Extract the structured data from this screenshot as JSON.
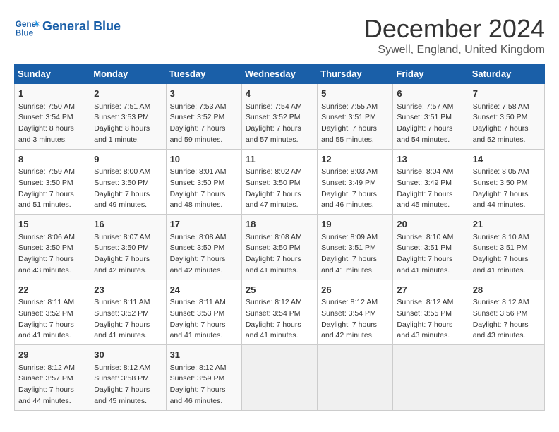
{
  "header": {
    "logo_text_general": "General",
    "logo_text_blue": "Blue",
    "month_year": "December 2024",
    "location": "Sywell, England, United Kingdom"
  },
  "days_of_week": [
    "Sunday",
    "Monday",
    "Tuesday",
    "Wednesday",
    "Thursday",
    "Friday",
    "Saturday"
  ],
  "weeks": [
    [
      {
        "day": "1",
        "sunrise": "Sunrise: 7:50 AM",
        "sunset": "Sunset: 3:54 PM",
        "daylight": "Daylight: 8 hours and 3 minutes."
      },
      {
        "day": "2",
        "sunrise": "Sunrise: 7:51 AM",
        "sunset": "Sunset: 3:53 PM",
        "daylight": "Daylight: 8 hours and 1 minute."
      },
      {
        "day": "3",
        "sunrise": "Sunrise: 7:53 AM",
        "sunset": "Sunset: 3:52 PM",
        "daylight": "Daylight: 7 hours and 59 minutes."
      },
      {
        "day": "4",
        "sunrise": "Sunrise: 7:54 AM",
        "sunset": "Sunset: 3:52 PM",
        "daylight": "Daylight: 7 hours and 57 minutes."
      },
      {
        "day": "5",
        "sunrise": "Sunrise: 7:55 AM",
        "sunset": "Sunset: 3:51 PM",
        "daylight": "Daylight: 7 hours and 55 minutes."
      },
      {
        "day": "6",
        "sunrise": "Sunrise: 7:57 AM",
        "sunset": "Sunset: 3:51 PM",
        "daylight": "Daylight: 7 hours and 54 minutes."
      },
      {
        "day": "7",
        "sunrise": "Sunrise: 7:58 AM",
        "sunset": "Sunset: 3:50 PM",
        "daylight": "Daylight: 7 hours and 52 minutes."
      }
    ],
    [
      {
        "day": "8",
        "sunrise": "Sunrise: 7:59 AM",
        "sunset": "Sunset: 3:50 PM",
        "daylight": "Daylight: 7 hours and 51 minutes."
      },
      {
        "day": "9",
        "sunrise": "Sunrise: 8:00 AM",
        "sunset": "Sunset: 3:50 PM",
        "daylight": "Daylight: 7 hours and 49 minutes."
      },
      {
        "day": "10",
        "sunrise": "Sunrise: 8:01 AM",
        "sunset": "Sunset: 3:50 PM",
        "daylight": "Daylight: 7 hours and 48 minutes."
      },
      {
        "day": "11",
        "sunrise": "Sunrise: 8:02 AM",
        "sunset": "Sunset: 3:50 PM",
        "daylight": "Daylight: 7 hours and 47 minutes."
      },
      {
        "day": "12",
        "sunrise": "Sunrise: 8:03 AM",
        "sunset": "Sunset: 3:49 PM",
        "daylight": "Daylight: 7 hours and 46 minutes."
      },
      {
        "day": "13",
        "sunrise": "Sunrise: 8:04 AM",
        "sunset": "Sunset: 3:49 PM",
        "daylight": "Daylight: 7 hours and 45 minutes."
      },
      {
        "day": "14",
        "sunrise": "Sunrise: 8:05 AM",
        "sunset": "Sunset: 3:50 PM",
        "daylight": "Daylight: 7 hours and 44 minutes."
      }
    ],
    [
      {
        "day": "15",
        "sunrise": "Sunrise: 8:06 AM",
        "sunset": "Sunset: 3:50 PM",
        "daylight": "Daylight: 7 hours and 43 minutes."
      },
      {
        "day": "16",
        "sunrise": "Sunrise: 8:07 AM",
        "sunset": "Sunset: 3:50 PM",
        "daylight": "Daylight: 7 hours and 42 minutes."
      },
      {
        "day": "17",
        "sunrise": "Sunrise: 8:08 AM",
        "sunset": "Sunset: 3:50 PM",
        "daylight": "Daylight: 7 hours and 42 minutes."
      },
      {
        "day": "18",
        "sunrise": "Sunrise: 8:08 AM",
        "sunset": "Sunset: 3:50 PM",
        "daylight": "Daylight: 7 hours and 41 minutes."
      },
      {
        "day": "19",
        "sunrise": "Sunrise: 8:09 AM",
        "sunset": "Sunset: 3:51 PM",
        "daylight": "Daylight: 7 hours and 41 minutes."
      },
      {
        "day": "20",
        "sunrise": "Sunrise: 8:10 AM",
        "sunset": "Sunset: 3:51 PM",
        "daylight": "Daylight: 7 hours and 41 minutes."
      },
      {
        "day": "21",
        "sunrise": "Sunrise: 8:10 AM",
        "sunset": "Sunset: 3:51 PM",
        "daylight": "Daylight: 7 hours and 41 minutes."
      }
    ],
    [
      {
        "day": "22",
        "sunrise": "Sunrise: 8:11 AM",
        "sunset": "Sunset: 3:52 PM",
        "daylight": "Daylight: 7 hours and 41 minutes."
      },
      {
        "day": "23",
        "sunrise": "Sunrise: 8:11 AM",
        "sunset": "Sunset: 3:52 PM",
        "daylight": "Daylight: 7 hours and 41 minutes."
      },
      {
        "day": "24",
        "sunrise": "Sunrise: 8:11 AM",
        "sunset": "Sunset: 3:53 PM",
        "daylight": "Daylight: 7 hours and 41 minutes."
      },
      {
        "day": "25",
        "sunrise": "Sunrise: 8:12 AM",
        "sunset": "Sunset: 3:54 PM",
        "daylight": "Daylight: 7 hours and 41 minutes."
      },
      {
        "day": "26",
        "sunrise": "Sunrise: 8:12 AM",
        "sunset": "Sunset: 3:54 PM",
        "daylight": "Daylight: 7 hours and 42 minutes."
      },
      {
        "day": "27",
        "sunrise": "Sunrise: 8:12 AM",
        "sunset": "Sunset: 3:55 PM",
        "daylight": "Daylight: 7 hours and 43 minutes."
      },
      {
        "day": "28",
        "sunrise": "Sunrise: 8:12 AM",
        "sunset": "Sunset: 3:56 PM",
        "daylight": "Daylight: 7 hours and 43 minutes."
      }
    ],
    [
      {
        "day": "29",
        "sunrise": "Sunrise: 8:12 AM",
        "sunset": "Sunset: 3:57 PM",
        "daylight": "Daylight: 7 hours and 44 minutes."
      },
      {
        "day": "30",
        "sunrise": "Sunrise: 8:12 AM",
        "sunset": "Sunset: 3:58 PM",
        "daylight": "Daylight: 7 hours and 45 minutes."
      },
      {
        "day": "31",
        "sunrise": "Sunrise: 8:12 AM",
        "sunset": "Sunset: 3:59 PM",
        "daylight": "Daylight: 7 hours and 46 minutes."
      },
      null,
      null,
      null,
      null
    ]
  ]
}
